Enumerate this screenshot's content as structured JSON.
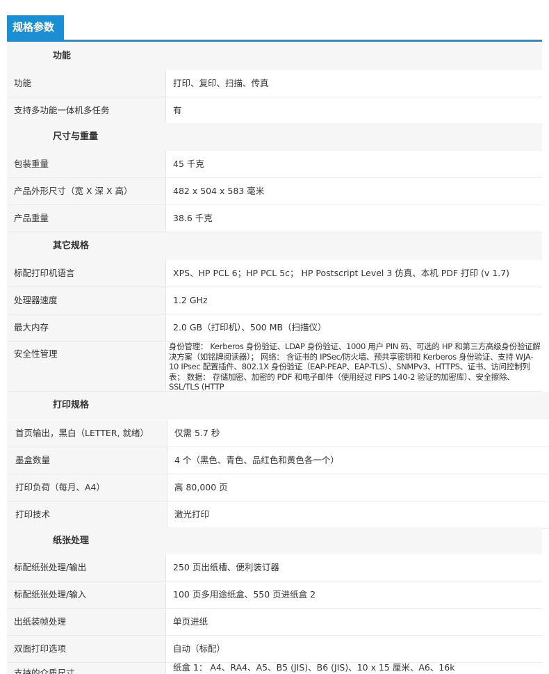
{
  "header": {
    "title": "规格参数"
  },
  "sections": [
    {
      "title": "功能",
      "rows": [
        {
          "label": "功能",
          "value": "打印、复印、扫描、传真"
        },
        {
          "label": "支持多功能一体机多任务",
          "value": "有"
        }
      ]
    },
    {
      "title": "尺寸与重量",
      "rows": [
        {
          "label": "包装重量",
          "value": "45 千克"
        },
        {
          "label": "产品外形尺寸（宽 X 深 X 高）",
          "value": "482 x 504 x 583 毫米"
        },
        {
          "label": "产品重量",
          "value": "38.6 千克"
        }
      ]
    },
    {
      "title": "其它规格",
      "rows": [
        {
          "label": "标配打印机语言",
          "value": "XPS、HP PCL 6；HP PCL 5c； HP Postscript Level 3 仿真、本机 PDF 打印 (v 1.7)"
        },
        {
          "label": "处理器速度",
          "value": "1.2 GHz"
        },
        {
          "label": "最大内存",
          "value": "2.0 GB（打印机）、500 MB（扫描仪）"
        },
        {
          "label": "安全性管理",
          "value": "身份管理： Kerberos 身份验证、LDAP 身份验证、1000 用户 PIN 码、可选的 HP 和第三方高级身份验证解决方案（如铭牌阅读器）； 网络： 含证书的 IPSec/防火墙、预共享密钥和 Kerberos 身份验证、支持 WJA-10 IPsec 配置插件、802.1X 身份验证（EAP-PEAP、EAP-TLS）、SNMPv3、HTTPS、证书、访问控制列表； 数据： 存储加密、加密的 PDF 和电子邮件（使用经过 FIPS 140-2 验证的加密库）、安全擦除、SSL/TLS (HTTP"
        }
      ]
    },
    {
      "title": "打印规格",
      "rows": [
        {
          "label": "首页输出，黑白（LETTER, 就绪）",
          "value": "仅需 5.7 秒"
        },
        {
          "label": "墨盒数量",
          "value": "4 个（黑色、青色、品红色和黄色各一个）"
        },
        {
          "label": "打印负荷（每月、A4）",
          "value": "高 80,000 页"
        },
        {
          "label": "打印技术",
          "value": "激光打印"
        }
      ]
    },
    {
      "title": "纸张处理",
      "rows": [
        {
          "label": "标配纸张处理/输出",
          "value": "250 页出纸槽、便利装订器"
        },
        {
          "label": "标配纸张处理/输入",
          "value": "100 页多用途纸盒、550 页进纸盒 2"
        },
        {
          "label": "出纸装帧处理",
          "value": "单页进纸"
        },
        {
          "label": "双面打印选项",
          "value": "自动（标配）"
        },
        {
          "label": "支持的介质尺寸",
          "value": "纸盒 1： A4、RA4、A5、B5 (JIS)、B6 (JIS)、10 x 15 厘米、A6、16k"
        }
      ]
    }
  ]
}
